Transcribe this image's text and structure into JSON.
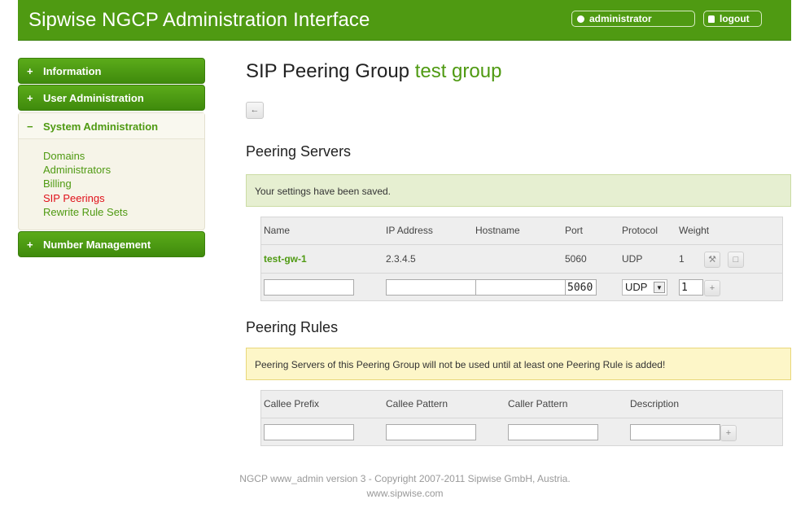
{
  "header": {
    "app_title": "Sipwise NGCP Administration Interface",
    "user": "administrator",
    "logout": "logout"
  },
  "sidebar": {
    "items": [
      {
        "sign": "+",
        "label": "Information"
      },
      {
        "sign": "+",
        "label": "User Administration"
      },
      {
        "sign": "−",
        "label": "System Administration"
      },
      {
        "sign": "+",
        "label": "Number Management"
      }
    ],
    "sub_items": [
      "Domains",
      "Administrators",
      "Billing",
      "SIP Peerings",
      "Rewrite Rule Sets"
    ],
    "active_sub_item": "SIP Peerings"
  },
  "main": {
    "title_prefix": "SIP Peering Group",
    "group_name": "test group",
    "back_icon": "arrow-left-icon",
    "servers": {
      "section_title": "Peering Servers",
      "success_message": "Your settings have been saved.",
      "columns": [
        "Name",
        "IP Address",
        "Hostname",
        "Port",
        "Protocol",
        "Weight"
      ],
      "rows": [
        {
          "name": "test-gw-1",
          "ip": "2.3.4.5",
          "hostname": "",
          "port": "5060",
          "protocol": "UDP",
          "weight": "1"
        }
      ],
      "new_row": {
        "name": "",
        "ip": "",
        "hostname": "",
        "port": "5060",
        "protocol": "UDP",
        "weight": "1"
      }
    },
    "rules": {
      "section_title": "Peering Rules",
      "warning_message": "Peering Servers of this Peering Group will not be used until at least one Peering Rule is added!",
      "columns": [
        "Callee Prefix",
        "Callee Pattern",
        "Caller Pattern",
        "Description"
      ],
      "new_row": {
        "callee_prefix": "",
        "callee_pattern": "",
        "caller_pattern": "",
        "description": ""
      }
    }
  },
  "footer": {
    "line1": "NGCP www_admin version 3 - Copyright 2007-2011 Sipwise GmbH, Austria.",
    "line2": "www.sipwise.com"
  },
  "colors": {
    "brand_green": "#4f9a12",
    "active_link": "#e0101a",
    "success_bg": "#e6efd1",
    "warning_bg": "#fdf6c8"
  }
}
